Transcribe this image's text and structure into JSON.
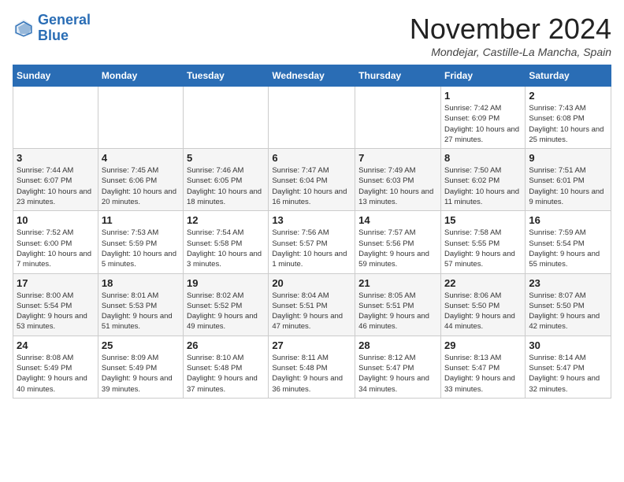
{
  "logo": {
    "line1": "General",
    "line2": "Blue"
  },
  "title": "November 2024",
  "location": "Mondejar, Castille-La Mancha, Spain",
  "days_of_week": [
    "Sunday",
    "Monday",
    "Tuesday",
    "Wednesday",
    "Thursday",
    "Friday",
    "Saturday"
  ],
  "weeks": [
    [
      {
        "day": "",
        "info": ""
      },
      {
        "day": "",
        "info": ""
      },
      {
        "day": "",
        "info": ""
      },
      {
        "day": "",
        "info": ""
      },
      {
        "day": "",
        "info": ""
      },
      {
        "day": "1",
        "info": "Sunrise: 7:42 AM\nSunset: 6:09 PM\nDaylight: 10 hours and 27 minutes."
      },
      {
        "day": "2",
        "info": "Sunrise: 7:43 AM\nSunset: 6:08 PM\nDaylight: 10 hours and 25 minutes."
      }
    ],
    [
      {
        "day": "3",
        "info": "Sunrise: 7:44 AM\nSunset: 6:07 PM\nDaylight: 10 hours and 23 minutes."
      },
      {
        "day": "4",
        "info": "Sunrise: 7:45 AM\nSunset: 6:06 PM\nDaylight: 10 hours and 20 minutes."
      },
      {
        "day": "5",
        "info": "Sunrise: 7:46 AM\nSunset: 6:05 PM\nDaylight: 10 hours and 18 minutes."
      },
      {
        "day": "6",
        "info": "Sunrise: 7:47 AM\nSunset: 6:04 PM\nDaylight: 10 hours and 16 minutes."
      },
      {
        "day": "7",
        "info": "Sunrise: 7:49 AM\nSunset: 6:03 PM\nDaylight: 10 hours and 13 minutes."
      },
      {
        "day": "8",
        "info": "Sunrise: 7:50 AM\nSunset: 6:02 PM\nDaylight: 10 hours and 11 minutes."
      },
      {
        "day": "9",
        "info": "Sunrise: 7:51 AM\nSunset: 6:01 PM\nDaylight: 10 hours and 9 minutes."
      }
    ],
    [
      {
        "day": "10",
        "info": "Sunrise: 7:52 AM\nSunset: 6:00 PM\nDaylight: 10 hours and 7 minutes."
      },
      {
        "day": "11",
        "info": "Sunrise: 7:53 AM\nSunset: 5:59 PM\nDaylight: 10 hours and 5 minutes."
      },
      {
        "day": "12",
        "info": "Sunrise: 7:54 AM\nSunset: 5:58 PM\nDaylight: 10 hours and 3 minutes."
      },
      {
        "day": "13",
        "info": "Sunrise: 7:56 AM\nSunset: 5:57 PM\nDaylight: 10 hours and 1 minute."
      },
      {
        "day": "14",
        "info": "Sunrise: 7:57 AM\nSunset: 5:56 PM\nDaylight: 9 hours and 59 minutes."
      },
      {
        "day": "15",
        "info": "Sunrise: 7:58 AM\nSunset: 5:55 PM\nDaylight: 9 hours and 57 minutes."
      },
      {
        "day": "16",
        "info": "Sunrise: 7:59 AM\nSunset: 5:54 PM\nDaylight: 9 hours and 55 minutes."
      }
    ],
    [
      {
        "day": "17",
        "info": "Sunrise: 8:00 AM\nSunset: 5:54 PM\nDaylight: 9 hours and 53 minutes."
      },
      {
        "day": "18",
        "info": "Sunrise: 8:01 AM\nSunset: 5:53 PM\nDaylight: 9 hours and 51 minutes."
      },
      {
        "day": "19",
        "info": "Sunrise: 8:02 AM\nSunset: 5:52 PM\nDaylight: 9 hours and 49 minutes."
      },
      {
        "day": "20",
        "info": "Sunrise: 8:04 AM\nSunset: 5:51 PM\nDaylight: 9 hours and 47 minutes."
      },
      {
        "day": "21",
        "info": "Sunrise: 8:05 AM\nSunset: 5:51 PM\nDaylight: 9 hours and 46 minutes."
      },
      {
        "day": "22",
        "info": "Sunrise: 8:06 AM\nSunset: 5:50 PM\nDaylight: 9 hours and 44 minutes."
      },
      {
        "day": "23",
        "info": "Sunrise: 8:07 AM\nSunset: 5:50 PM\nDaylight: 9 hours and 42 minutes."
      }
    ],
    [
      {
        "day": "24",
        "info": "Sunrise: 8:08 AM\nSunset: 5:49 PM\nDaylight: 9 hours and 40 minutes."
      },
      {
        "day": "25",
        "info": "Sunrise: 8:09 AM\nSunset: 5:49 PM\nDaylight: 9 hours and 39 minutes."
      },
      {
        "day": "26",
        "info": "Sunrise: 8:10 AM\nSunset: 5:48 PM\nDaylight: 9 hours and 37 minutes."
      },
      {
        "day": "27",
        "info": "Sunrise: 8:11 AM\nSunset: 5:48 PM\nDaylight: 9 hours and 36 minutes."
      },
      {
        "day": "28",
        "info": "Sunrise: 8:12 AM\nSunset: 5:47 PM\nDaylight: 9 hours and 34 minutes."
      },
      {
        "day": "29",
        "info": "Sunrise: 8:13 AM\nSunset: 5:47 PM\nDaylight: 9 hours and 33 minutes."
      },
      {
        "day": "30",
        "info": "Sunrise: 8:14 AM\nSunset: 5:47 PM\nDaylight: 9 hours and 32 minutes."
      }
    ]
  ]
}
